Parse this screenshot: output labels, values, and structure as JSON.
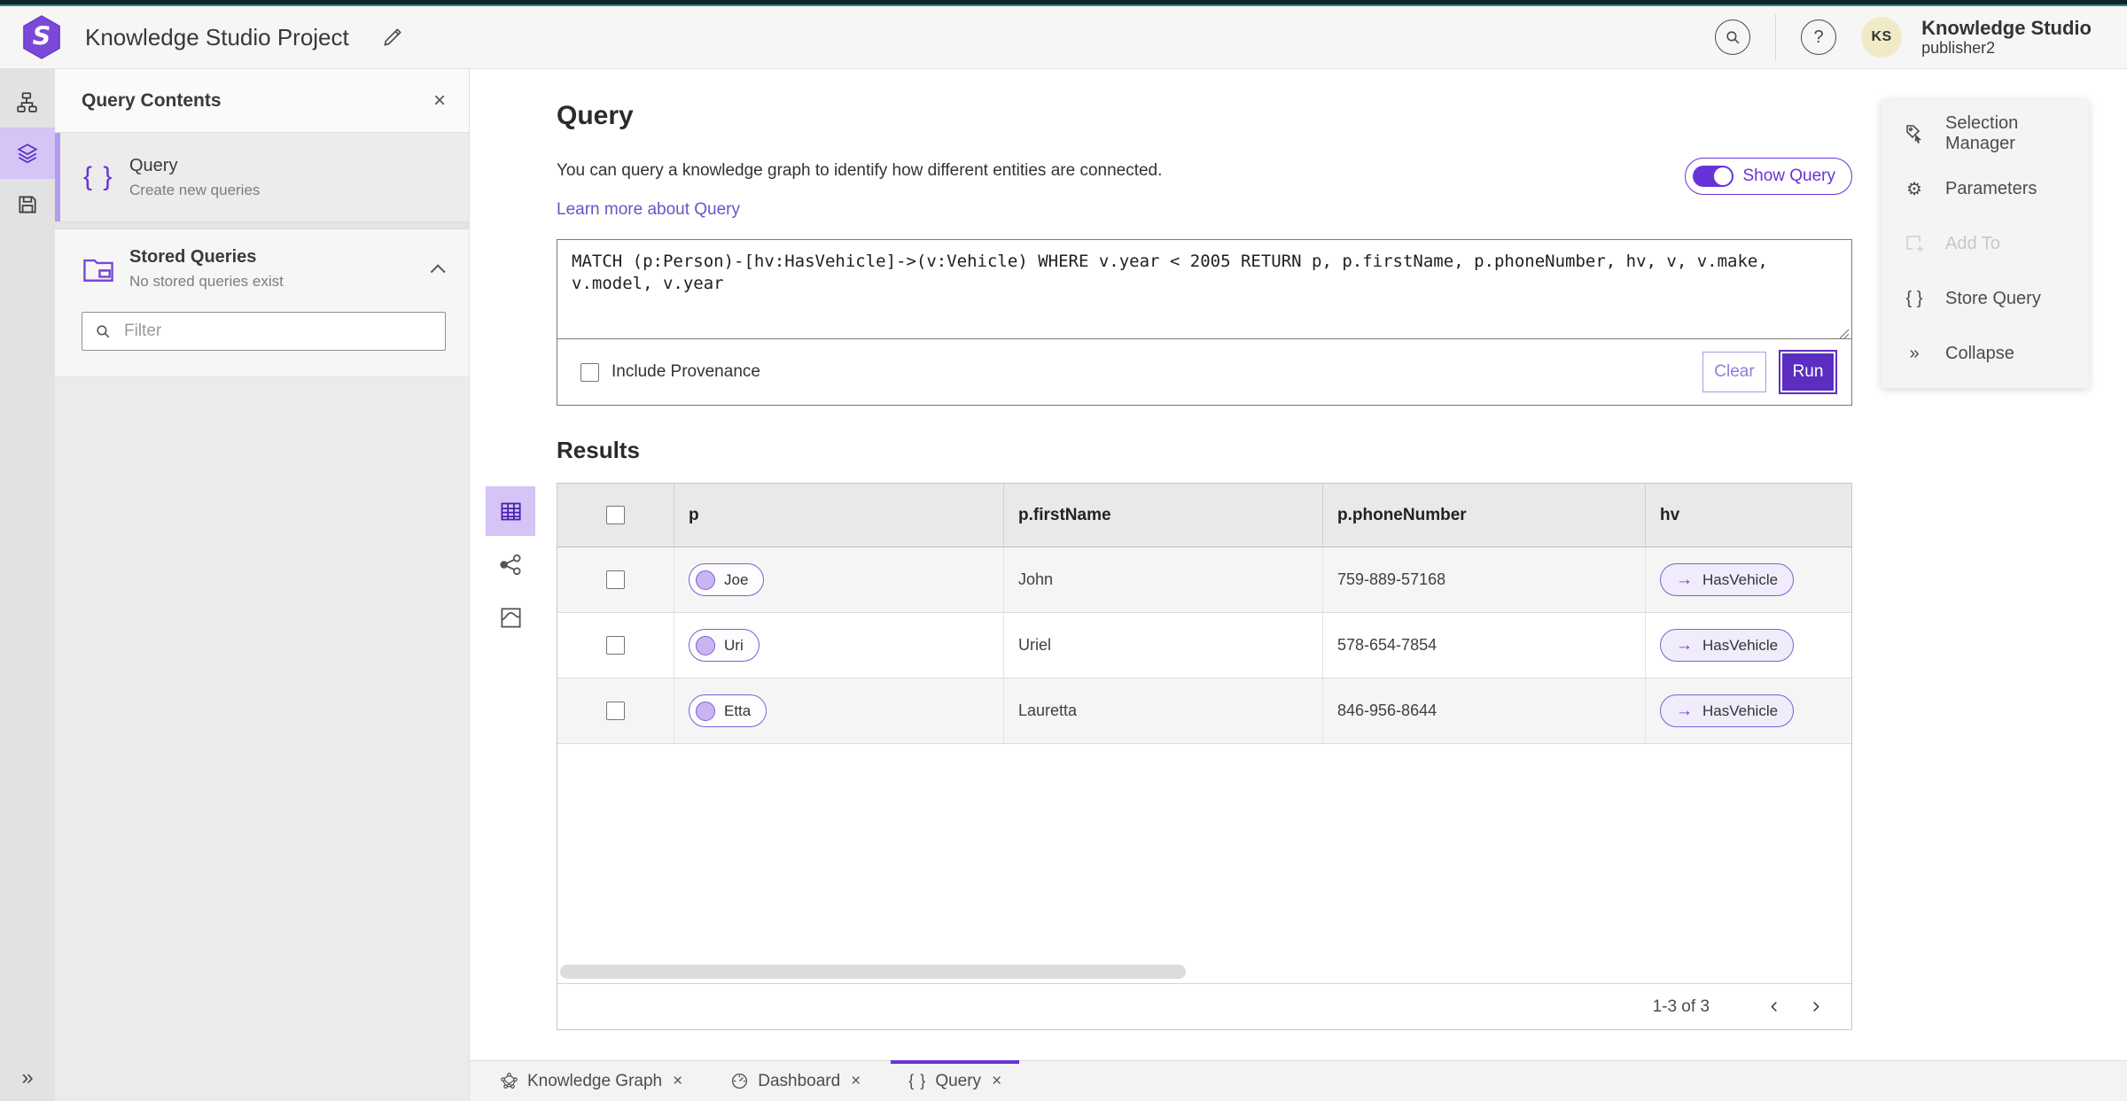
{
  "header": {
    "title": "Knowledge Studio Project",
    "user_name": "Knowledge Studio",
    "user_role": "publisher2",
    "avatar_initials": "KS"
  },
  "left_panel": {
    "title": "Query Contents",
    "query_item": {
      "title": "Query",
      "subtitle": "Create new queries"
    },
    "stored_queries": {
      "title": "Stored Queries",
      "subtitle": "No stored queries exist"
    },
    "filter_placeholder": "Filter"
  },
  "main": {
    "title": "Query",
    "description": "You can query a knowledge graph to identify how different entities are connected.",
    "learn_more": "Learn more about Query",
    "show_query_label": "Show Query",
    "query_text": "MATCH (p:Person)-[hv:HasVehicle]->(v:Vehicle) WHERE v.year < 2005 RETURN p, p.firstName, p.phoneNumber, hv, v, v.make, v.model, v.year",
    "include_provenance_label": "Include Provenance",
    "clear_label": "Clear",
    "run_label": "Run",
    "results_title": "Results"
  },
  "results_table": {
    "columns": [
      "p",
      "p.firstName",
      "p.phoneNumber",
      "hv"
    ],
    "rows": [
      {
        "p": "Joe",
        "firstName": "John",
        "phoneNumber": "759-889-57168",
        "hv": "HasVehicle"
      },
      {
        "p": "Uri",
        "firstName": "Uriel",
        "phoneNumber": "578-654-7854",
        "hv": "HasVehicle"
      },
      {
        "p": "Etta",
        "firstName": "Lauretta",
        "phoneNumber": "846-956-8644",
        "hv": "HasVehicle"
      }
    ],
    "pagination": "1-3 of 3"
  },
  "right_panel": {
    "items": [
      {
        "label": "Selection Manager"
      },
      {
        "label": "Parameters"
      },
      {
        "label": "Add To"
      },
      {
        "label": "Store Query"
      },
      {
        "label": "Collapse"
      }
    ]
  },
  "bottom_tabs": [
    {
      "label": "Knowledge Graph"
    },
    {
      "label": "Dashboard"
    },
    {
      "label": "Query"
    }
  ],
  "icons": {
    "close": "×",
    "help": "?",
    "braces": "{ }",
    "collapse_double_chevron": "»",
    "edge_arrow": "→"
  },
  "colors": {
    "accent_purple": "#6733D9",
    "run_button": "#5B2EC1",
    "active_highlight": "#D5C4F6",
    "top_strip_dark": "#10242E",
    "top_strip_teal": "#45807D",
    "avatar_bg": "#F0EBC6"
  }
}
